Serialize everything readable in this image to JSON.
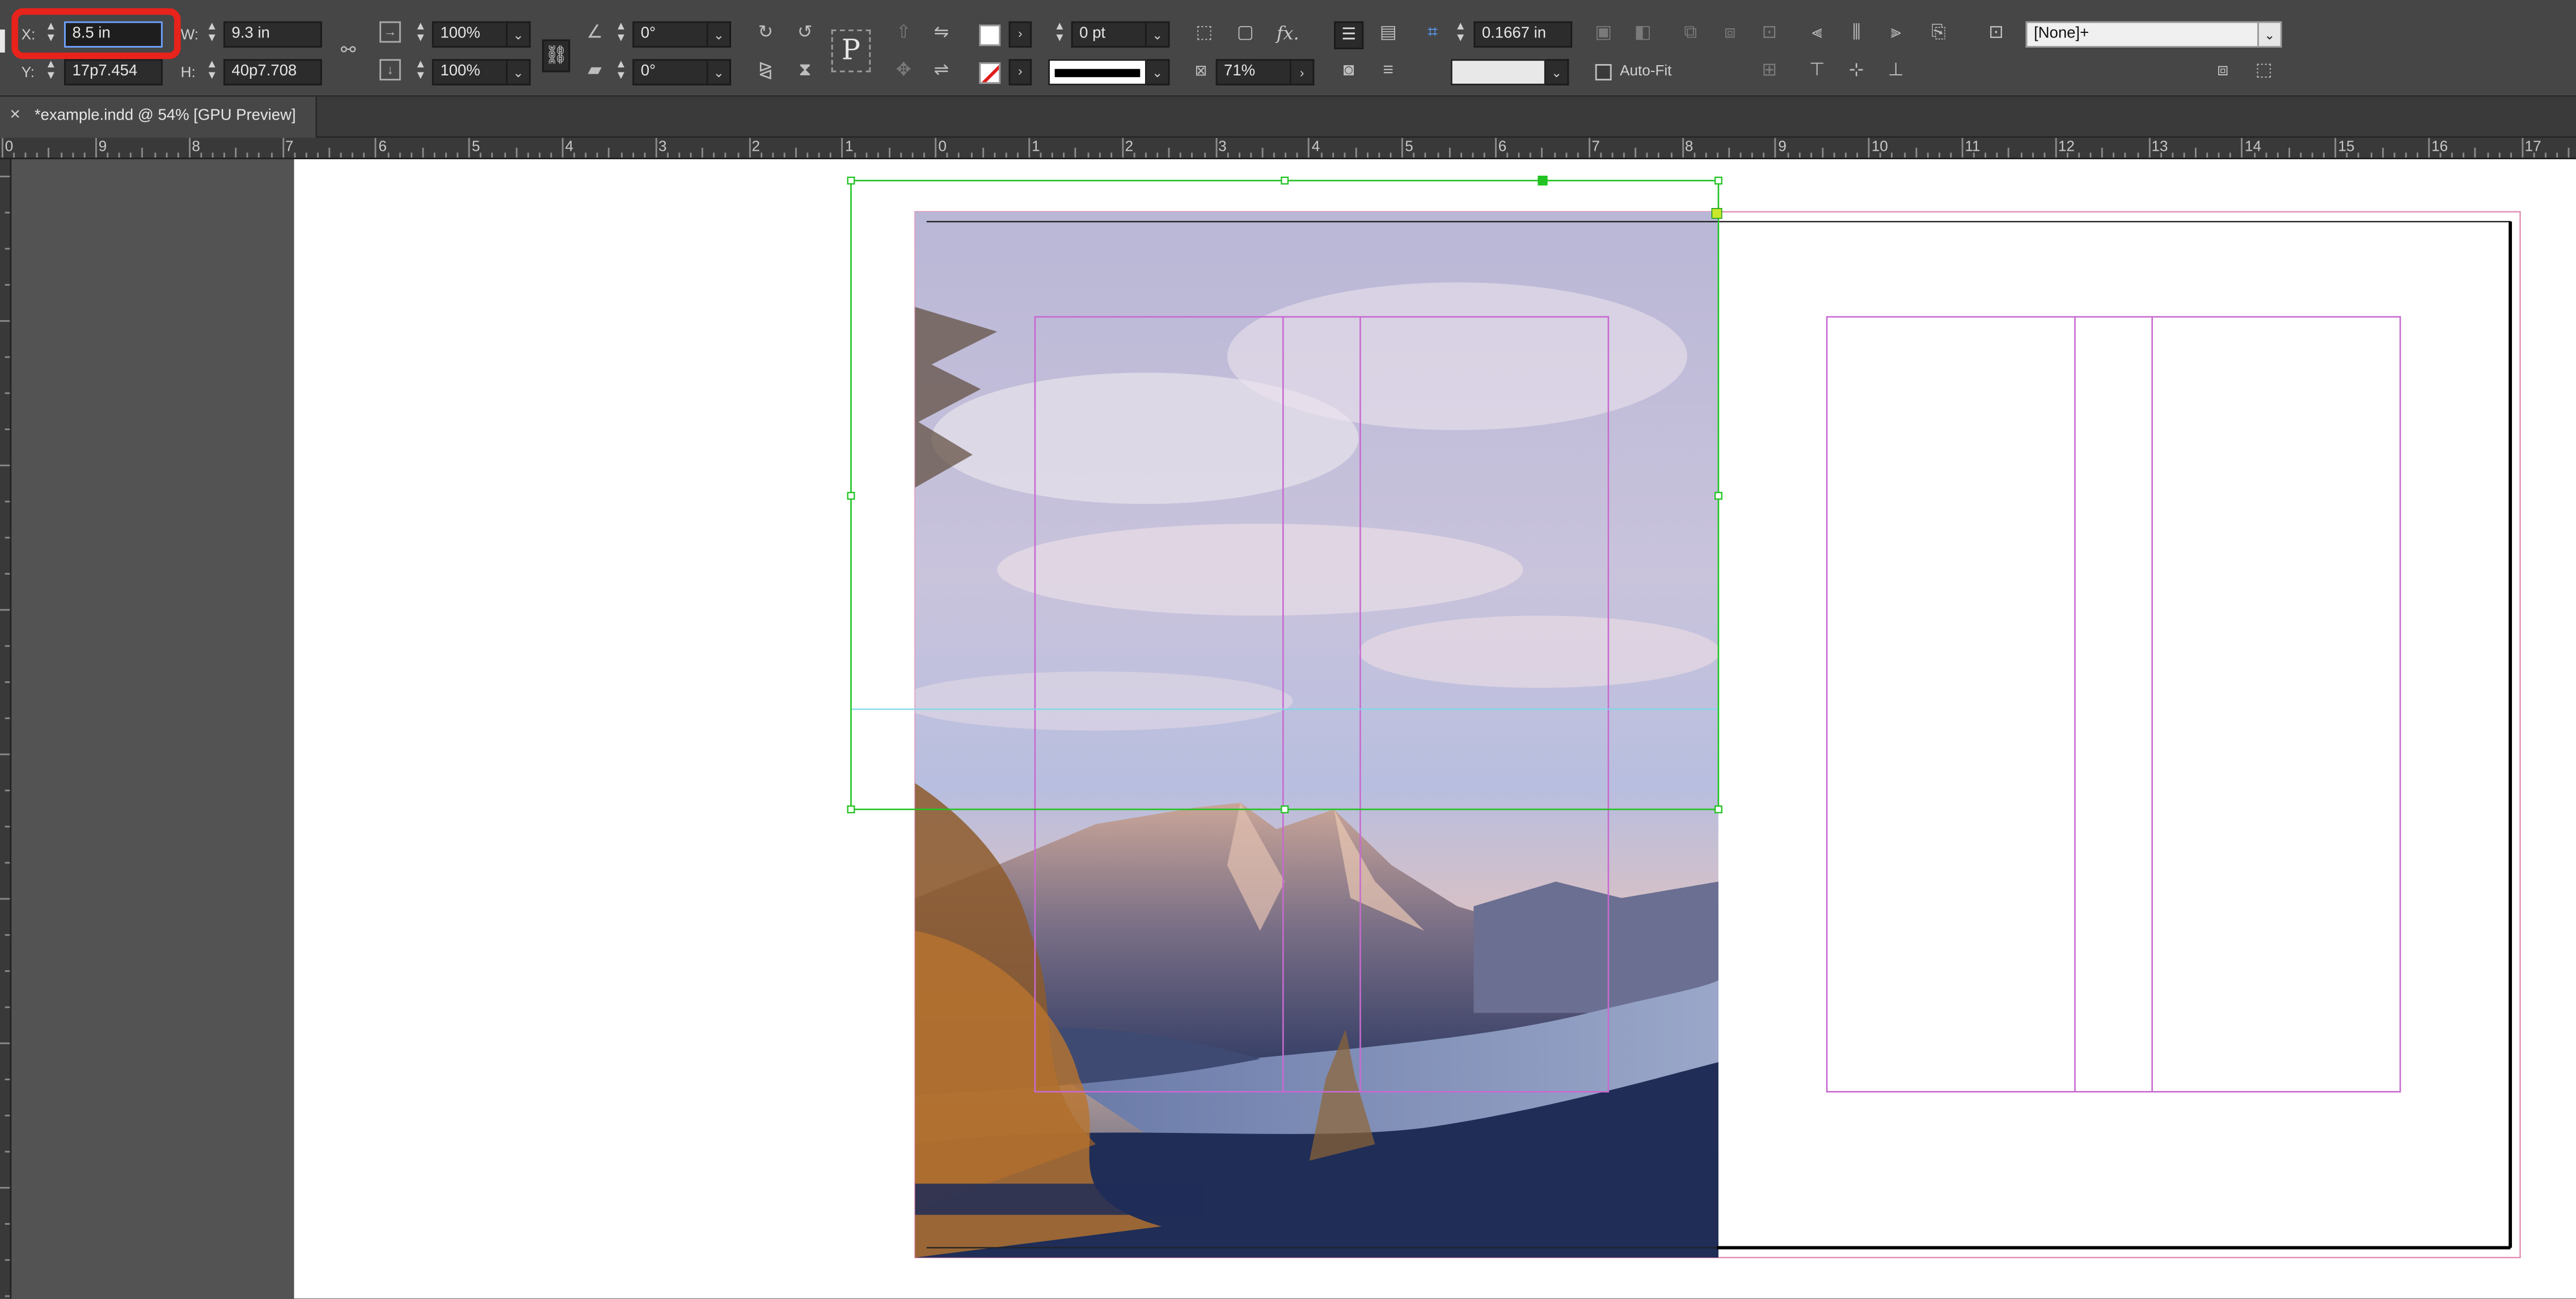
{
  "document_tab": {
    "close_glyph": "×",
    "title": "*example.indd @ 54% [GPU Preview]"
  },
  "control_panel": {
    "x": {
      "label": "X:",
      "value": "8.5 in"
    },
    "y": {
      "label": "Y:",
      "value": "17p7.454"
    },
    "w": {
      "label": "W:",
      "value": "9.3 in"
    },
    "h": {
      "label": "H:",
      "value": "40p7.708"
    },
    "scale_x": "100%",
    "scale_y": "100%",
    "rotate": "0°",
    "shear": "0°",
    "stroke_weight": "0 pt",
    "opacity": "71%",
    "offset": "0.1667 in",
    "object_style": "[None]+",
    "auto_fit_label": "Auto-Fit",
    "auto_fit_checked": false,
    "reference_point_glyph": "P",
    "fx_label": "fx."
  },
  "horizontal_ruler": {
    "labels": [
      "0",
      "9",
      "8",
      "7",
      "6",
      "5",
      "4",
      "3",
      "2",
      "1",
      "0",
      "1",
      "2",
      "3",
      "4",
      "5",
      "6",
      "7",
      "8",
      "9",
      "10",
      "11",
      "12",
      "13",
      "14",
      "15",
      "16",
      "17"
    ]
  },
  "colors": {
    "highlight": "#e8231b",
    "selection": "#22c322",
    "margin_guides": "#c86ad0",
    "bleed": "#e08ab0",
    "pasteboard": "#535353",
    "panel": "#464646",
    "sky_top": "#b9b7d6",
    "water": "#4d628f",
    "navy_band": "#1f2d57"
  },
  "icons": {
    "constrain": "chain-link-icon",
    "rotate_cw": "rotate-clockwise-icon",
    "rotate_ccw": "rotate-counterclockwise-icon",
    "flip_h": "flip-horizontal-icon",
    "flip_v": "flip-vertical-icon",
    "fill_swatch": "fill-swatch-icon",
    "stroke_swatch": "stroke-swatch-icon",
    "effects": "fx-icon",
    "align_left": "align-left-icon",
    "align_center": "align-center-icon",
    "align_right": "align-right-icon"
  }
}
